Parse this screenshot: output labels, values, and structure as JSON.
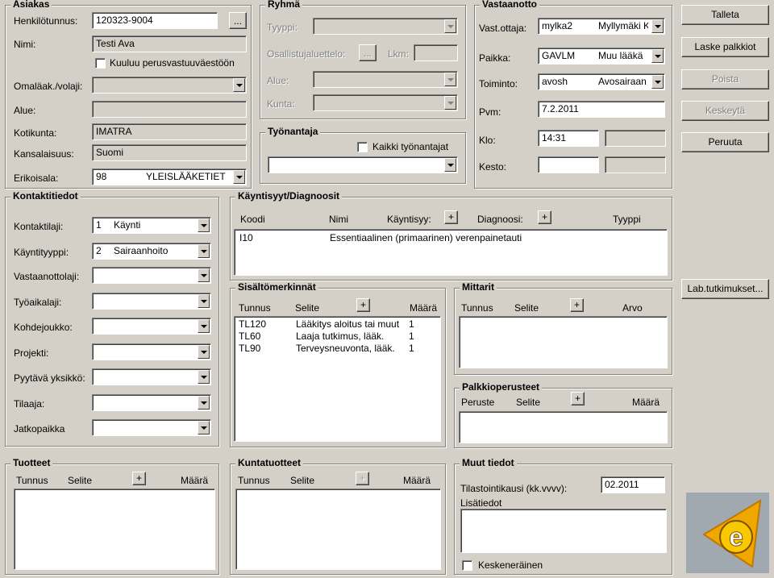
{
  "asiakas": {
    "title": "Asiakas",
    "henkilotunnus_label": "Henkilötunnus:",
    "henkilotunnus_value": "120323-9004",
    "browse": "...",
    "nimi_label": "Nimi:",
    "nimi_value": "Testi Ava",
    "perusvastuu_label": "Kuuluu perusvastuuväestöön",
    "omalaakari_label": "Omaläak./volaji:",
    "alue_label": "Alue:",
    "kotikunta_label": "Kotikunta:",
    "kotikunta_value": "IMATRA",
    "kansalaisuus_label": "Kansalaisuus:",
    "kansalaisuus_value": "Suomi",
    "erikoisala_label": "Erikoisala:",
    "erikoisala_code": "98",
    "erikoisala_value": "YLEISLÄÄKETIET"
  },
  "ryhma": {
    "title": "Ryhmä",
    "tyyppi_label": "Tyyppi:",
    "osallistuja_label": "Osallistujaluettelo:",
    "browse": "...",
    "lkm_label": "Lkm:",
    "alue_label": "Alue:",
    "kunta_label": "Kunta:"
  },
  "tyonantaja": {
    "title": "Työnantaja",
    "kaikki_label": "Kaikki työnantajat"
  },
  "vastaanotto": {
    "title": "Vastaanotto",
    "vastottaja_label": "Vast.ottaja:",
    "vastottaja_code": "mylka2",
    "vastottaja_name": "Myllymäki K",
    "paikka_label": "Paikka:",
    "paikka_code": "GAVLM",
    "paikka_name": "Muu lääkä",
    "toiminto_label": "Toiminto:",
    "toiminto_code": "avosh",
    "toiminto_name": "Avosairaan",
    "pvm_label": "Pvm:",
    "pvm_value": "7.2.2011",
    "klo_label": "Klo:",
    "klo_value": "14:31",
    "kesto_label": "Kesto:"
  },
  "buttons": {
    "talleta": "Talleta",
    "laske": "Laske palkkiot",
    "poista": "Poista",
    "keskeyta": "Keskeytä",
    "peruuta": "Peruuta",
    "lab": "Lab.tutkimukset..."
  },
  "kontakti": {
    "title": "Kontaktitiedot",
    "kontaktilaji_label": "Kontaktilaji:",
    "kontaktilaji_code": "1",
    "kontaktilaji_value": "Käynti",
    "kayntityyppi_label": "Käyntityyppi:",
    "kayntityyppi_code": "2",
    "kayntityyppi_value": "Sairaanhoito",
    "vastaanottolaji_label": "Vastaanottolaji:",
    "tyoaikalaji_label": "Työaikalaji:",
    "kohdejoukko_label": "Kohdejoukko:",
    "projekti_label": "Projekti:",
    "pyytava_label": "Pyytävä yksikkö:",
    "tilaaja_label": "Tilaaja:",
    "jatkopaikka_label": "Jatkopaikka"
  },
  "kayntisyyt": {
    "title": "Käyntisyyt/Diagnoosit",
    "col_koodi": "Koodi",
    "col_nimi": "Nimi",
    "col_kayntisyy": "Käyntisyy:",
    "col_diagnoosi": "Diagnoosi:",
    "col_tyyppi": "Tyyppi",
    "rows": [
      {
        "koodi": "I10",
        "nimi": "Essentiaalinen (primaarinen) verenpainetauti"
      }
    ]
  },
  "sisalto": {
    "title": "Sisältömerkinnät",
    "col_tunnus": "Tunnus",
    "col_selite": "Selite",
    "col_maara": "Määrä",
    "rows": [
      {
        "tunnus": "TL120",
        "selite": "Lääkitys aloitus tai muut",
        "maara": "1"
      },
      {
        "tunnus": "TL60",
        "selite": "Laaja tutkimus, lääk.",
        "maara": "1"
      },
      {
        "tunnus": "TL90",
        "selite": "Terveysneuvonta, lääk.",
        "maara": "1"
      }
    ]
  },
  "mittarit": {
    "title": "Mittarit",
    "col_tunnus": "Tunnus",
    "col_selite": "Selite",
    "col_arvo": "Arvo"
  },
  "palkkio": {
    "title": "Palkkioperusteet",
    "col_peruste": "Peruste",
    "col_selite": "Selite",
    "col_maara": "Määrä"
  },
  "tuotteet": {
    "title": "Tuotteet",
    "col_tunnus": "Tunnus",
    "col_selite": "Selite",
    "col_maara": "Määrä"
  },
  "kuntatuotteet": {
    "title": "Kuntatuotteet",
    "col_tunnus": "Tunnus",
    "col_selite": "Selite",
    "col_maara": "Määrä"
  },
  "muut": {
    "title": "Muut tiedot",
    "tilasto_label": "Tilastointikausi (kk.vvvv):",
    "tilasto_value": "02.2011",
    "lisatiedot_label": "Lisätiedot",
    "kesken_label": "Keskeneräinen"
  },
  "plus": "+",
  "logo": {
    "letter": "e",
    "color": "#f0a800"
  }
}
